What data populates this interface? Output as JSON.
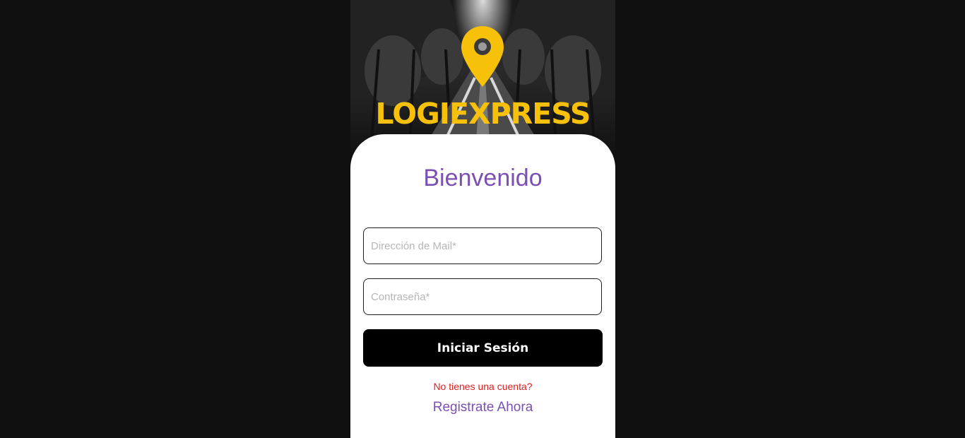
{
  "brand": {
    "name": "LOGIEXPRESS",
    "logo_icon": "location-pin-icon",
    "accent_color": "#f7c10a"
  },
  "login": {
    "title": "Bienvenido",
    "email_placeholder": "Dirección de Mail*",
    "password_placeholder": "Contraseña*",
    "submit_label": "Iniciar Sesión",
    "no_account_text": "No tienes una cuenta?",
    "register_link": "Registrate Ahora"
  },
  "colors": {
    "title": "#7b4fb3",
    "warning": "#e21b1b",
    "button": "#000000",
    "page_background": "#0f0f0f"
  }
}
